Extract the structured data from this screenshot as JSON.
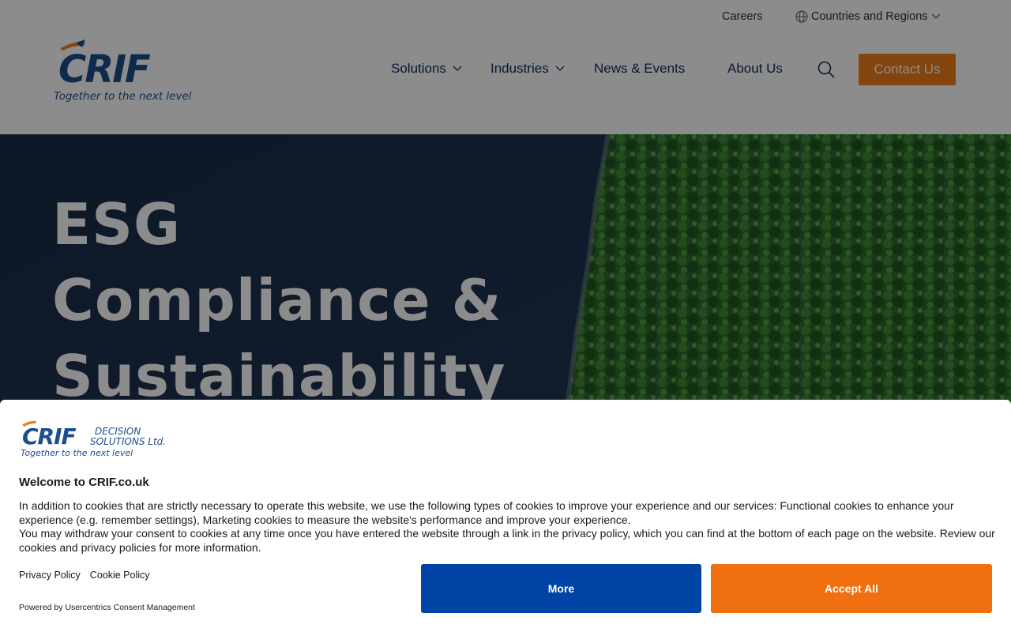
{
  "header": {
    "topbar": {
      "careers": "Careers",
      "regions": "Countries and Regions"
    },
    "logo": {
      "brand": "CRIF",
      "tagline": "Together to the next level"
    },
    "nav": {
      "solutions": "Solutions",
      "industries": "Industries",
      "news": "News & Events",
      "about": "About Us",
      "contact": "Contact Us"
    }
  },
  "hero": {
    "title_line1": "ESG",
    "title_line2": "Compliance &",
    "title_line3": "Sustainability"
  },
  "cookie_banner": {
    "logo": {
      "brand": "CRIF",
      "subtitle_line1": "DECISION",
      "subtitle_line2": "SOLUTIONS Ltd.",
      "tagline": "Together to the next level"
    },
    "title": "Welcome to CRIF.co.uk",
    "paragraph1": "In addition to cookies that are strictly necessary to operate this website, we use the following types of cookies to improve your experience and our services: Functional cookies to enhance your experience (e.g. remember settings), Marketing cookies to measure the website's performance and improve your experience.",
    "paragraph2": "You may withdraw your consent to cookies at any time once you have entered the website through a link in the privacy policy, which you can find at the bottom of each page on the website. Review our cookies and privacy policies for more information.",
    "privacy_link": "Privacy Policy",
    "cookie_link": "Cookie Policy",
    "powered_by": "Powered by Usercentrics Consent Management",
    "more_button": "More",
    "accept_button": "Accept All"
  },
  "colors": {
    "brand_blue": "#1b4f8f",
    "accent_orange": "#f07c1b",
    "more_button": "#0045a5",
    "accept_button": "#f07011"
  }
}
